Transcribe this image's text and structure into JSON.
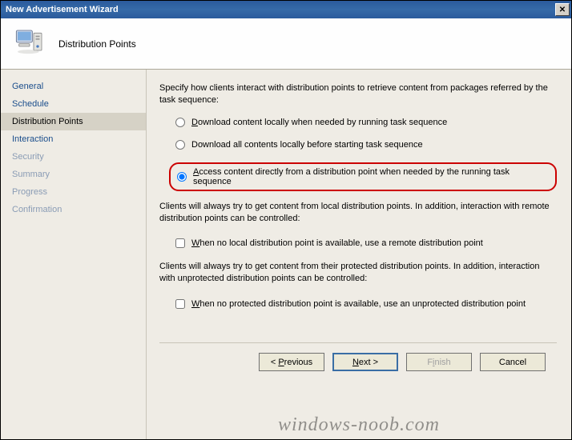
{
  "window": {
    "title": "New Advertisement Wizard"
  },
  "header": {
    "title": "Distribution Points"
  },
  "sidebar": {
    "items": [
      {
        "label": "General"
      },
      {
        "label": "Schedule"
      },
      {
        "label": "Distribution Points"
      },
      {
        "label": "Interaction"
      },
      {
        "label": "Security"
      },
      {
        "label": "Summary"
      },
      {
        "label": "Progress"
      },
      {
        "label": "Confirmation"
      }
    ],
    "active_index": 2
  },
  "content": {
    "intro": "Specify how clients interact with distribution points to retrieve content from packages referred by the task sequence:",
    "radios": [
      {
        "prefix": "D",
        "label": "ownload content locally when needed by running task sequence",
        "checked": false
      },
      {
        "prefix": "",
        "label": "Download all contents locally before starting task sequence",
        "checked": false
      },
      {
        "prefix": "A",
        "label": "ccess content directly from a distribution point when needed by the running task sequence",
        "checked": true
      }
    ],
    "paragraph1": "Clients will always try to get content from local distribution points. In addition, interaction with remote distribution points can be controlled:",
    "checkbox1": {
      "prefix": "W",
      "label": "hen no local distribution point is available, use a remote distribution point",
      "checked": false
    },
    "paragraph2": "Clients will always try to get content from their protected distribution points. In addition, interaction with unprotected distribution points can be controlled:",
    "checkbox2": {
      "prefix": "W",
      "label": "hen no protected distribution point is available, use an unprotected distribution point",
      "checked": false
    }
  },
  "buttons": {
    "previous_prefix": "< ",
    "previous_u": "P",
    "previous_suffix": "revious",
    "next_prefix": "",
    "next_u": "N",
    "next_suffix": "ext >",
    "finish_prefix": "F",
    "finish_u": "i",
    "finish_suffix": "nish",
    "cancel": "Cancel"
  },
  "watermark": "windows-noob.com"
}
